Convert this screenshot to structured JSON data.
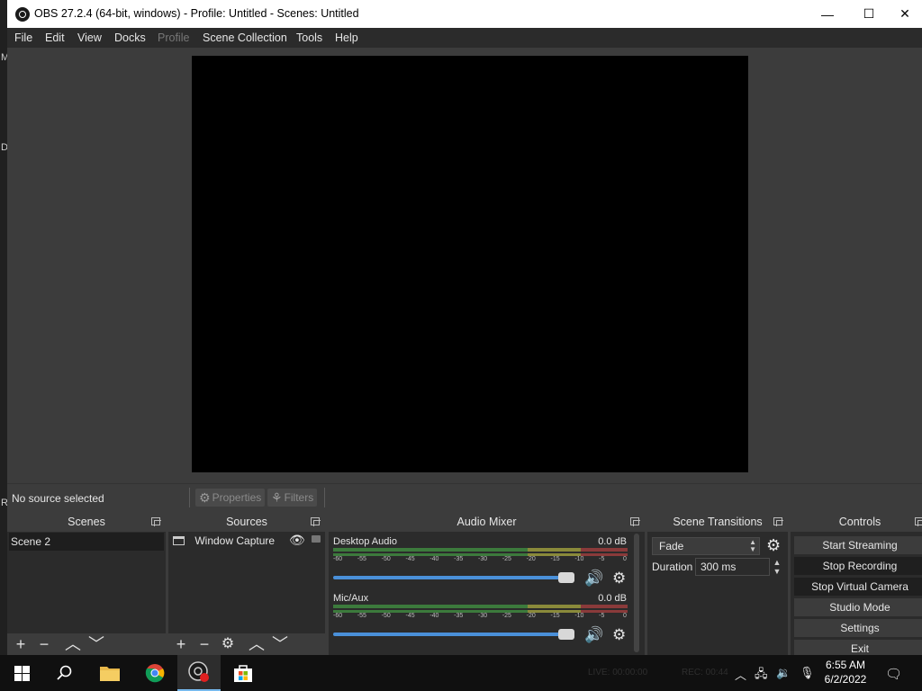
{
  "background_window": {
    "letters": [
      "M",
      "D",
      "R"
    ]
  },
  "window": {
    "title": "OBS 27.2.4 (64-bit, windows) - Profile: Untitled - Scenes: Untitled",
    "minimize_glyph": "—",
    "maximize_glyph": "☐",
    "close_glyph": "✕"
  },
  "menu": {
    "items": [
      "File",
      "Edit",
      "View",
      "Docks",
      "Profile",
      "Scene Collection",
      "Tools",
      "Help"
    ]
  },
  "context_bar": {
    "no_source": "No source selected",
    "properties_label": "Properties",
    "filters_label": "Filters"
  },
  "scenes": {
    "title": "Scenes",
    "items": [
      "Scene 2"
    ]
  },
  "sources": {
    "title": "Sources",
    "items": [
      {
        "label": "Window Capture"
      }
    ]
  },
  "audio_mixer": {
    "title": "Audio Mixer",
    "ticks": [
      "-60",
      "-55",
      "-50",
      "-45",
      "-40",
      "-35",
      "-30",
      "-25",
      "-20",
      "-15",
      "-10",
      "-5",
      "0"
    ],
    "channels": [
      {
        "name": "Desktop Audio",
        "db": "0.0 dB",
        "volume": 1.0
      },
      {
        "name": "Mic/Aux",
        "db": "0.0 dB",
        "volume": 1.0
      }
    ]
  },
  "scene_transitions": {
    "title": "Scene Transitions",
    "transition": "Fade",
    "duration_label": "Duration",
    "duration_value": "300 ms"
  },
  "controls": {
    "title": "Controls",
    "start_streaming": "Start Streaming",
    "stop_recording": "Stop Recording",
    "stop_virtual_camera": "Stop Virtual Camera",
    "studio_mode": "Studio Mode",
    "settings": "Settings",
    "exit": "Exit"
  },
  "status_bar": {
    "live": "LIVE: 00:00:00",
    "rec": "REC: 00:44"
  },
  "taskbar": {
    "time": "6:55 AM",
    "date": "6/2/2022"
  },
  "colors": {
    "panel": "#3c3c3c",
    "dock_body": "#2b2b2b",
    "fader": "#4a90d9",
    "obs_rec_badge": "#e02020"
  }
}
